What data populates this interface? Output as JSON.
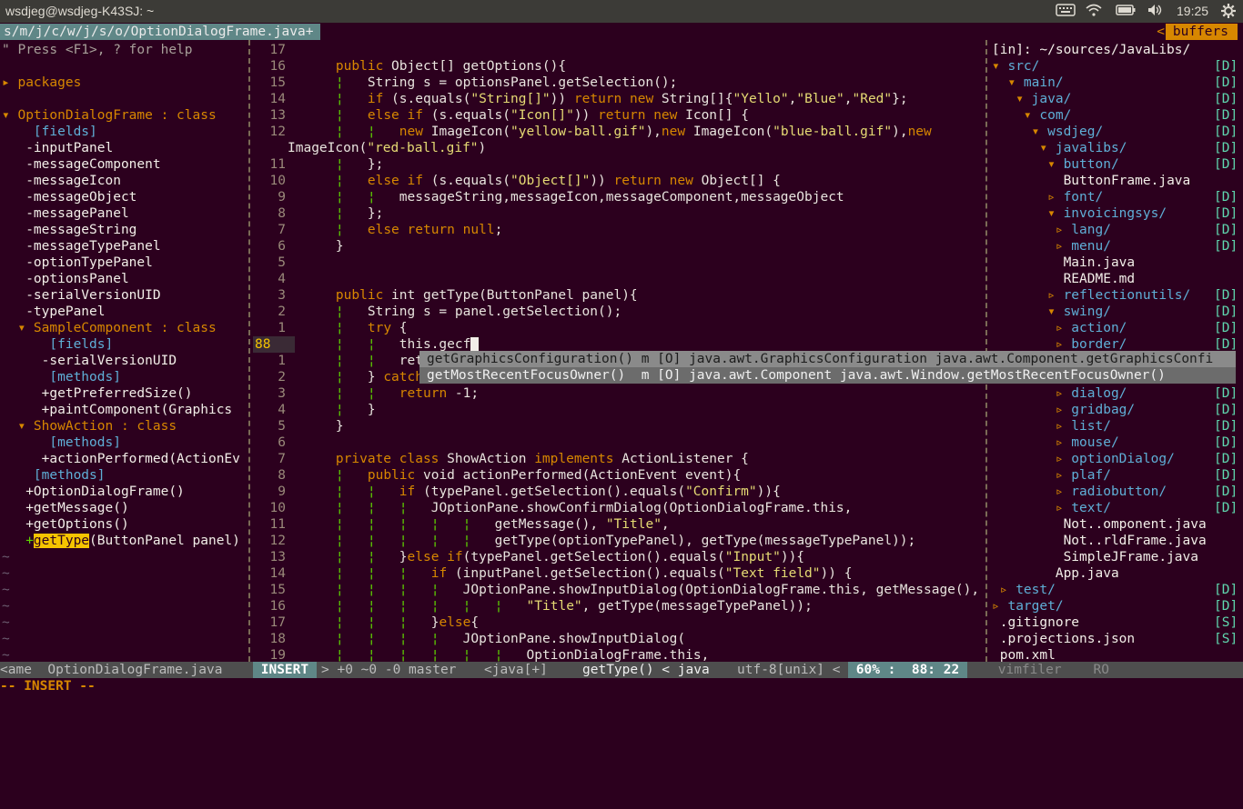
{
  "topbar": {
    "title": "wsdjeg@wsdjeg-K43SJ: ~",
    "time": "19:25",
    "icons": [
      "keyboard-icon",
      "wifi-icon",
      "battery-icon",
      "volume-icon",
      "gear-icon"
    ]
  },
  "tabline": {
    "tab_label": "s/m/j/c/w/j/s/o/OptionDialogFrame.java+",
    "buffers_label": "buffers",
    "buffers_arrow": "<"
  },
  "tagbar": {
    "lines": [
      "\" Press <F1>, ? for help",
      "",
      "▸ packages",
      "",
      "▾ OptionDialogFrame : class",
      "    [fields]",
      "   -inputPanel",
      "   -messageComponent",
      "   -messageIcon",
      "   -messageObject",
      "   -messagePanel",
      "   -messageString",
      "   -messageTypePanel",
      "   -optionTypePanel",
      "   -optionsPanel",
      "   -serialVersionUID",
      "   -typePanel",
      "  ▾ SampleComponent : class",
      "      [fields]",
      "     -serialVersionUID",
      "      [methods]",
      "     +getPreferredSize()",
      "     +paintComponent(Graphics",
      "  ▾ ShowAction : class",
      "      [methods]",
      "     +actionPerformed(ActionEv",
      "    [methods]",
      "   +OptionDialogFrame()",
      "   +getMessage()",
      "   +getOptions()",
      "   +getType(ButtonPanel panel)",
      "~",
      "~",
      "~",
      "~",
      "~",
      "~",
      "~"
    ]
  },
  "editor": {
    "numbers": [
      "17",
      "16",
      "15",
      "14",
      "13",
      "12",
      "",
      "11",
      "10",
      "9",
      "8",
      "7",
      "6",
      "5",
      "4",
      "3",
      "2",
      "1",
      "88",
      "1",
      "2",
      "3",
      "4",
      "5",
      "6",
      "7",
      "8",
      "9",
      "10",
      "11",
      "12",
      "13",
      "14",
      "15",
      "16",
      "17",
      "18",
      "19"
    ],
    "code": [
      "",
      "    public Object[] getOptions(){",
      "    ¦   String s = optionsPanel.getSelection();",
      "    ¦   if (s.equals(\"String[]\")) return new String[]{\"Yello\",\"Blue\",\"Red\"};",
      "    ¦   else if (s.equals(\"Icon[]\")) return new Icon[] {",
      "    ¦   ¦   new ImageIcon(\"yellow-ball.gif\"),new ImageIcon(\"blue-ball.gif\"),new",
      "ImageIcon(\"red-ball.gif\")",
      "    ¦   };",
      "    ¦   else if (s.equals(\"Object[]\")) return new Object[] {",
      "    ¦   ¦   messageString,messageIcon,messageComponent,messageObject",
      "    ¦   };",
      "    ¦   else return null;",
      "    }",
      "",
      "",
      "    public int getType(ButtonPanel panel){",
      "    ¦   String s = panel.getSelection();",
      "    ¦   try {",
      "    ¦   ¦   this.gecf",
      "    ¦   ¦   retu",
      "    ¦   } catch",
      "    ¦   ¦   return -1;",
      "    ¦   }",
      "    }",
      "",
      "    private class ShowAction implements ActionListener {",
      "    ¦   public void actionPerformed(ActionEvent event){",
      "    ¦   ¦   if (typePanel.getSelection().equals(\"Confirm\")){",
      "    ¦   ¦   ¦   JOptionPane.showConfirmDialog(OptionDialogFrame.this,",
      "    ¦   ¦   ¦   ¦   ¦   getMessage(), \"Title\",",
      "    ¦   ¦   ¦   ¦   ¦   getType(optionTypePanel), getType(messageTypePanel));",
      "    ¦   ¦   }else if(typePanel.getSelection().equals(\"Input\")){",
      "    ¦   ¦   ¦   if (inputPanel.getSelection().equals(\"Text field\")) {",
      "    ¦   ¦   ¦   ¦   JOptionPane.showInputDialog(OptionDialogFrame.this, getMessage(),",
      "    ¦   ¦   ¦   ¦   ¦   ¦   \"Title\", getType(messageTypePanel));",
      "    ¦   ¦   ¦   }else{",
      "    ¦   ¦   ¦   ¦   JOptionPane.showInputDialog(",
      "    ¦   ¦   ¦   ¦   ¦   ¦   OptionDialogFrame.this,"
    ]
  },
  "completion": {
    "items": [
      "getGraphicsConfiguration() m [O] java.awt.GraphicsConfiguration java.awt.Component.getGraphicsConfi",
      "getMostRecentFocusOwner()  m [O] java.awt.Component java.awt.Window.getMostRecentFocusOwner()"
    ]
  },
  "vimfiler": {
    "header": "[in]: ~/sources/JavaLibs/",
    "rows": [
      {
        "name": "▾ src/",
        "flag": "[D]"
      },
      {
        "name": "  ▾ main/",
        "flag": "[D]"
      },
      {
        "name": "   ▾ java/",
        "flag": "[D]"
      },
      {
        "name": "    ▾ com/",
        "flag": "[D]"
      },
      {
        "name": "     ▾ wsdjeg/",
        "flag": "[D]"
      },
      {
        "name": "      ▾ javalibs/",
        "flag": "[D]"
      },
      {
        "name": "       ▾ button/",
        "flag": "[D]"
      },
      {
        "name": "         ButtonFrame.java",
        "flag": ""
      },
      {
        "name": "       ▹ font/",
        "flag": "[D]"
      },
      {
        "name": "       ▾ invoicingsys/",
        "flag": "[D]"
      },
      {
        "name": "        ▹ lang/",
        "flag": "[D]"
      },
      {
        "name": "        ▹ menu/",
        "flag": "[D]"
      },
      {
        "name": "         Main.java",
        "flag": ""
      },
      {
        "name": "         README.md",
        "flag": ""
      },
      {
        "name": "       ▹ reflectionutils/",
        "flag": "[D]"
      },
      {
        "name": "       ▾ swing/",
        "flag": "[D]"
      },
      {
        "name": "        ▹ action/",
        "flag": "[D]"
      },
      {
        "name": "        ▹ border/",
        "flag": "[D]"
      },
      {
        "name": "",
        "flag": "[D]"
      },
      {
        "name": "",
        "flag": "[D]"
      },
      {
        "name": "        ▹ dialog/",
        "flag": "[D]"
      },
      {
        "name": "        ▹ gridbag/",
        "flag": "[D]"
      },
      {
        "name": "        ▹ list/",
        "flag": "[D]"
      },
      {
        "name": "        ▹ mouse/",
        "flag": "[D]"
      },
      {
        "name": "        ▹ optionDialog/",
        "flag": "[D]"
      },
      {
        "name": "        ▹ plaf/",
        "flag": "[D]"
      },
      {
        "name": "        ▹ radiobutton/",
        "flag": "[D]"
      },
      {
        "name": "        ▹ text/",
        "flag": "[D]"
      },
      {
        "name": "         Not..omponent.java",
        "flag": ""
      },
      {
        "name": "         Not..rldFrame.java",
        "flag": ""
      },
      {
        "name": "         SimpleJFrame.java",
        "flag": ""
      },
      {
        "name": "        App.java",
        "flag": ""
      },
      {
        "name": " ▹ test/",
        "flag": "[D]"
      },
      {
        "name": "▹ target/",
        "flag": "[D]"
      },
      {
        "name": " .gitignore",
        "flag": "[S]"
      },
      {
        "name": " .projections.json",
        "flag": "[S]"
      },
      {
        "name": " pom.xml",
        "flag": ""
      }
    ]
  },
  "statusline": {
    "left": "<ame  OptionDialogFrame.java",
    "mode": " INSERT ",
    "git": "> +0 ~0 -0 master",
    "filetype": "<java[+]",
    "func": "getType() < java",
    "encoding": "utf-8[unix] <",
    "position": " 60% :  88: 22 ",
    "filer": " vimfiler    RO"
  },
  "cmdline": "-- INSERT --",
  "colors": {
    "background": "#2c001e",
    "accent": "#d78700",
    "highlight": "#f5c400",
    "tab": "#5f8787"
  }
}
